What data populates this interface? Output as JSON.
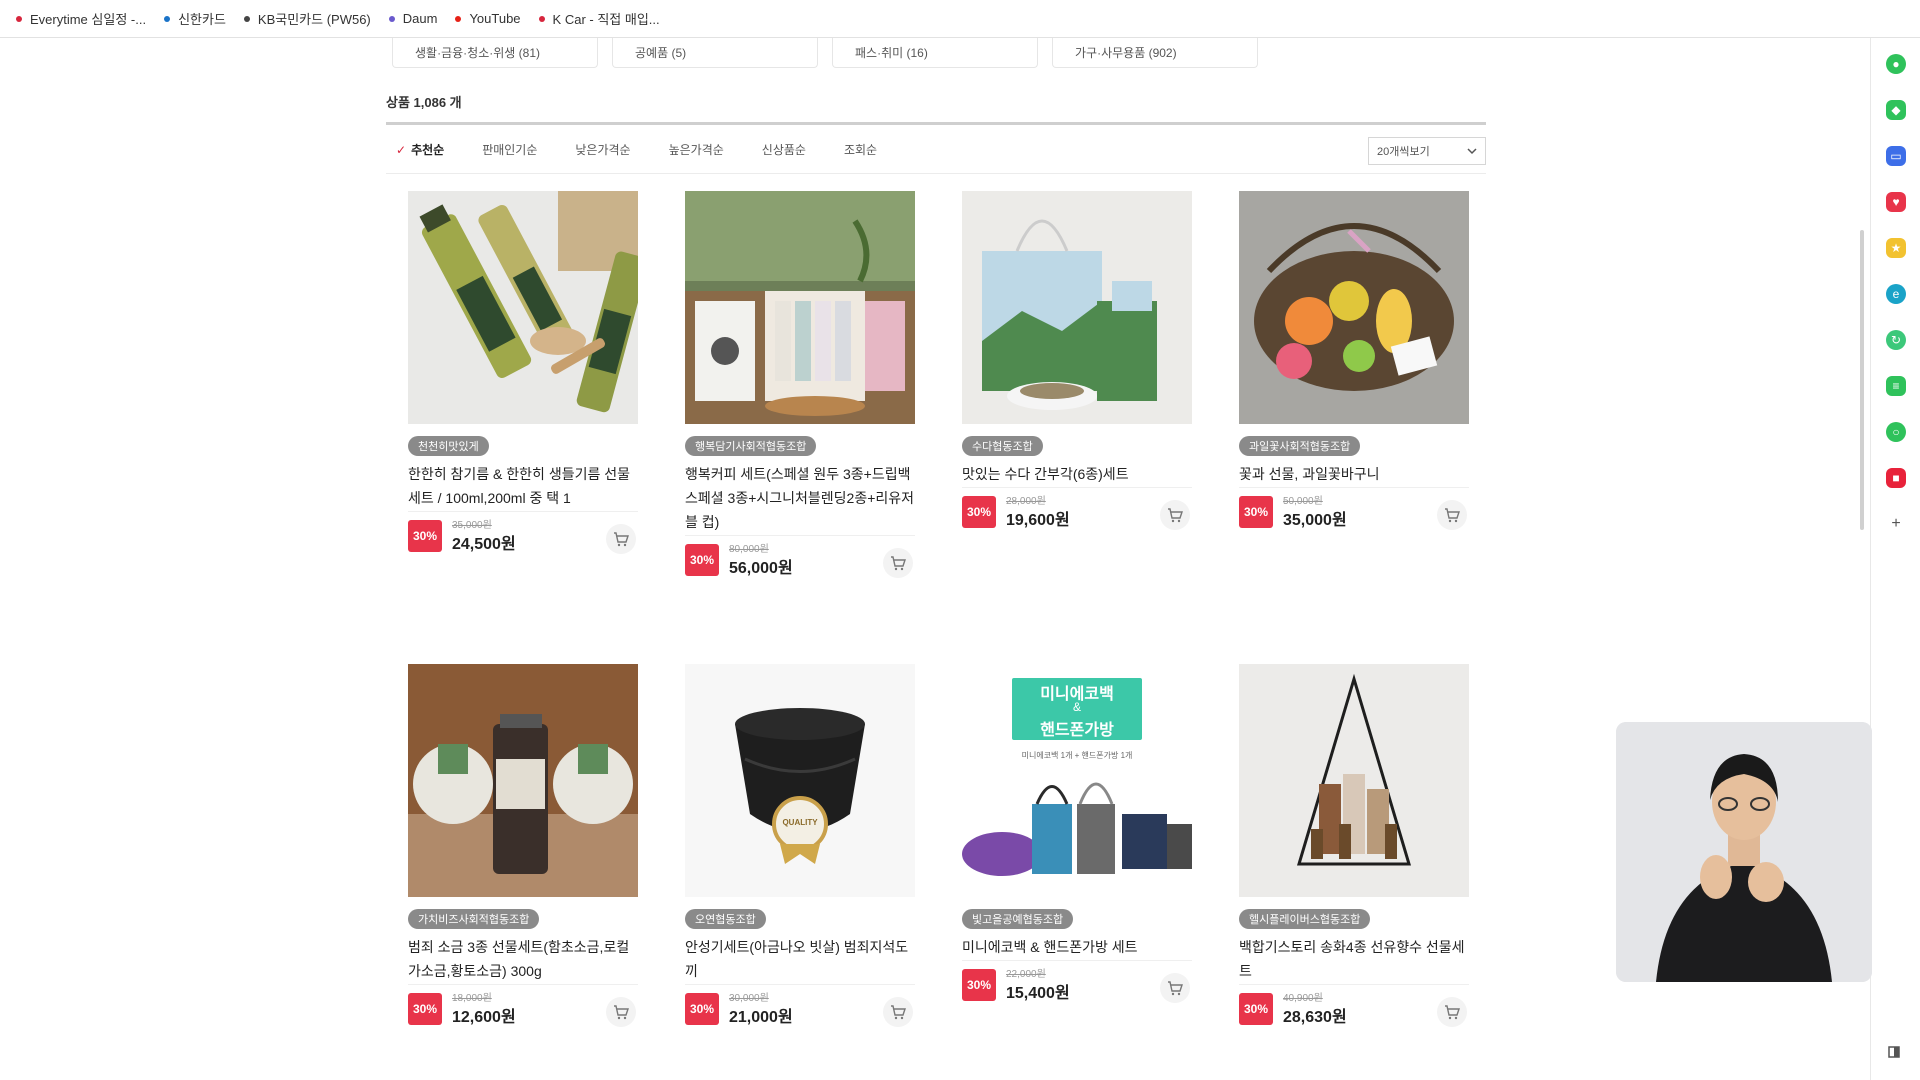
{
  "bookmarks": [
    {
      "label": "Everytime 심일정 -...",
      "color": "#d7263d"
    },
    {
      "label": "신한카드",
      "color": "#1a73c8"
    },
    {
      "label": "KB국민카드 (PW56)",
      "color": "#444444"
    },
    {
      "label": "Daum",
      "color": "#6a5acd"
    },
    {
      "label": "YouTube",
      "color": "#e62117"
    },
    {
      "label": "K Car - 직접 매입...",
      "color": "#d7263d"
    }
  ],
  "categories": [
    "생활·금융·청소·위생 (81)",
    "공예품 (5)",
    "패스·취미 (16)",
    "가구·사무용품 (902)"
  ],
  "product_count": "상품 1,086 개",
  "sort": {
    "items": [
      "추천순",
      "판매인기순",
      "낮은가격순",
      "높은가격순",
      "신상품순",
      "조회순"
    ],
    "per_page": "20개씩보기"
  },
  "products": [
    {
      "shop": "천천히맛있게",
      "name": "한한히 참기름 & 한한히 생들기름 선물세트 / 100ml,200ml 중 택 1",
      "discount": "30%",
      "original_price": "35,000원",
      "price": "24,500원"
    },
    {
      "shop": "행복담기사회적협동조합",
      "name": "행복커피 세트(스페셜 원두 3종+드립백 스페셜 3종+시그니처블렌딩2종+리유저블 컵)",
      "discount": "30%",
      "original_price": "80,000원",
      "price": "56,000원"
    },
    {
      "shop": "수다협동조합",
      "name": "맛있는 수다 간부각(6종)세트",
      "discount": "30%",
      "original_price": "28,000원",
      "price": "19,600원"
    },
    {
      "shop": "과일꽃사회적협동조합",
      "name": "꽃과 선물, 과일꽃바구니",
      "discount": "30%",
      "original_price": "50,000원",
      "price": "35,000원"
    },
    {
      "shop": "가치비즈사회적협동조합",
      "name": "범죄 소금 3종 선물세트(함초소금,로컬가소금,황토소금) 300g",
      "discount": "30%",
      "original_price": "18,000원",
      "price": "12,600원"
    },
    {
      "shop": "오연협동조합",
      "name": "안성기세트(아금나오 빗살) 범죄지석도끼",
      "discount": "30%",
      "original_price": "30,000원",
      "price": "21,000원"
    },
    {
      "shop": "빛고을공예협동조합",
      "name": "미니에코백 & 핸드폰가방 세트",
      "discount": "30%",
      "original_price": "22,000원",
      "price": "15,400원"
    },
    {
      "shop": "헬시플레이버스협동조합",
      "name": "백합기스토리 송화4종 선유향수 선물세트",
      "discount": "30%",
      "original_price": "40,900원",
      "price": "28,630원"
    }
  ],
  "thumb_promo": {
    "line1": "미니에코백",
    "line2": "&",
    "line3": "핸드폰가방",
    "sub": "미니에코백 1개 + 핸드폰가방 1개",
    "quality": "QUALITY"
  },
  "colors": {
    "accent": "#e8344a",
    "badge": "#8a8a8a"
  }
}
